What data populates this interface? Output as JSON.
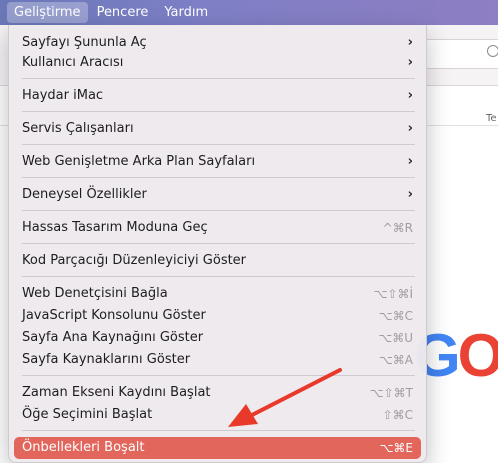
{
  "menubar": {
    "items": [
      "Geliştirme",
      "Pencere",
      "Yardım"
    ]
  },
  "background": {
    "tab_text": "Te",
    "logo_letters": [
      "G",
      "O"
    ]
  },
  "menu": {
    "items": [
      {
        "label": "Sayfayı Şununla Aç",
        "shortcut": "",
        "submenu": true
      },
      {
        "label": "Kullanıcı Aracısı",
        "shortcut": "",
        "submenu": true
      },
      {
        "label": "Haydar iMac",
        "shortcut": "",
        "submenu": true
      },
      {
        "label": "Servis Çalışanları",
        "shortcut": "",
        "submenu": true
      },
      {
        "label": "Web Genişletme Arka Plan Sayfaları",
        "shortcut": "",
        "submenu": true
      },
      {
        "label": "Deneysel Özellikler",
        "shortcut": "",
        "submenu": true
      },
      {
        "label": "Hassas Tasarım Moduna Geç",
        "shortcut": "^⌘R",
        "submenu": false
      },
      {
        "label": "Kod Parçacığı Düzenleyiciyi Göster",
        "shortcut": "",
        "submenu": false
      },
      {
        "label": "Web Denetçisini Bağla",
        "shortcut": "⌥⇧⌘İ",
        "submenu": false
      },
      {
        "label": "JavaScript Konsolunu Göster",
        "shortcut": "⌥⌘C",
        "submenu": false
      },
      {
        "label": "Sayfa Ana Kaynağını Göster",
        "shortcut": "⌥⌘U",
        "submenu": false
      },
      {
        "label": "Sayfa Kaynaklarını Göster",
        "shortcut": "⌥⌘A",
        "submenu": false
      },
      {
        "label": "Zaman Ekseni Kaydını Başlat",
        "shortcut": "⌥⇧⌘T",
        "submenu": false
      },
      {
        "label": "Öğe Seçimini Başlat",
        "shortcut": "⇧⌘C",
        "submenu": false
      },
      {
        "label": "Önbellekleri Boşalt",
        "shortcut": "⌥⌘E",
        "submenu": false
      }
    ],
    "chevron": "›",
    "highlight_color": "#e2665c"
  },
  "annotation": {
    "arrow_color": "#e8392b"
  }
}
